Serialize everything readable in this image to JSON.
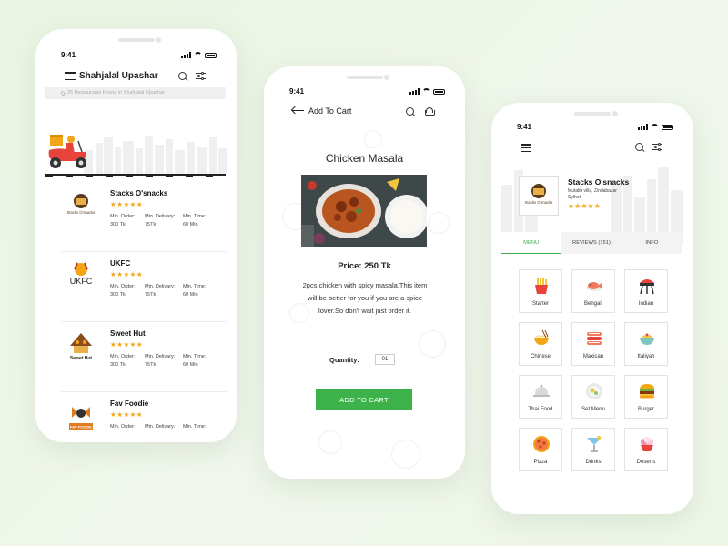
{
  "colors": {
    "accent": "#3db24a",
    "star": "#f2a516",
    "background": "#eaf5e2"
  },
  "status_time": "9:41",
  "restaurants_screen": {
    "title": "Shahjalal Upashar",
    "location_text": "25 Restaurants Found in Shahjalal Upashar",
    "restaurants": [
      {
        "name": "Stacks O'snacks",
        "stars": "★★★★★",
        "min_order_label": "Min. Order:",
        "min_order": "300 Tk",
        "min_delivery_label": "Min. Delivary:",
        "min_delivery": "75Tk",
        "min_time_label": "Min. Time:",
        "min_time": "60 Min",
        "logo_text": "Stacks O'snacks"
      },
      {
        "name": "UKFC",
        "stars": "★★★★★",
        "min_order_label": "Min. Order:",
        "min_order": "300 Tk",
        "min_delivery_label": "Min. Delivary:",
        "min_delivery": "75Tk",
        "min_time_label": "Min. Time:",
        "min_time": "60 Min",
        "logo_text": "UKFC"
      },
      {
        "name": "Sweet Hut",
        "stars": "★★★★★",
        "min_order_label": "Min. Order:",
        "min_order": "300 Tk",
        "min_delivery_label": "Min. Delivary:",
        "min_delivery": "75Tk",
        "min_time_label": "Min. Time:",
        "min_time": "60 Min",
        "logo_text": "Sweet Hut"
      },
      {
        "name": "Fav Foodie",
        "stars": "★★★★★",
        "min_order_label": "Min. Order:",
        "min_order": "",
        "min_delivery_label": "Min. Delivary:",
        "min_delivery": "",
        "min_time_label": "Min. Time:",
        "min_time": "",
        "logo_text": "FAV FOODIE"
      }
    ]
  },
  "cart_screen": {
    "title": "Add To Cart",
    "dish_title": "Chicken Masala",
    "price": "Price: 250 Tk",
    "description": "2pcs chicken with spicy masala.This item will be better for you if you are a spice lover.So don't wait just order it.",
    "quantity_label": "Quantity:",
    "quantity_value": "01",
    "add_button": "ADD TO CART"
  },
  "menu_screen": {
    "restaurant_name": "Stacks O'snacks",
    "address": "Mutalib villa, Zindabazar Sylhet.",
    "stars": "★★★★★",
    "logo_text": "Stacks O'snacks",
    "tabs": [
      "MENU",
      "REVIEWS (151)",
      "INFO"
    ],
    "categories": [
      {
        "label": "Starter",
        "icon": "fries-icon"
      },
      {
        "label": "Bengali",
        "icon": "fish-icon"
      },
      {
        "label": "Indian",
        "icon": "grill-icon"
      },
      {
        "label": "Chinese",
        "icon": "noodle-bowl-icon"
      },
      {
        "label": "Maxican",
        "icon": "tacos-icon"
      },
      {
        "label": "Italiyan",
        "icon": "pasta-bowl-icon"
      },
      {
        "label": "Thai Food",
        "icon": "cloche-icon"
      },
      {
        "label": "Set Menu",
        "icon": "plate-icon"
      },
      {
        "label": "Burger",
        "icon": "burger-icon"
      },
      {
        "label": "Pizza",
        "icon": "pizza-icon"
      },
      {
        "label": "Drinks",
        "icon": "cocktail-icon"
      },
      {
        "label": "Deserts",
        "icon": "ice-cream-icon"
      }
    ]
  }
}
